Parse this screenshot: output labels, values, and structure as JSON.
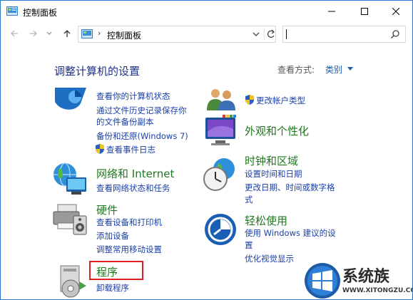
{
  "window": {
    "title": "控制面板",
    "accent": "#2b78d0"
  },
  "address_bar": {
    "separator": "›",
    "path": "控制面板"
  },
  "search": {
    "placeholder": ""
  },
  "header": {
    "heading": "调整计算机的设置",
    "view_by_label": "查看方式:",
    "view_by_value": "类别"
  },
  "categories": {
    "system": {
      "links": [
        "查看你的计算机状态",
        "通过文件历史记录保存你",
        "的文件备份副本",
        "备份和还原(Windows 7)",
        "查看事件日志"
      ]
    },
    "network": {
      "title": "网络和 Internet",
      "links": [
        "查看网络状态和任务"
      ]
    },
    "hardware": {
      "title": "硬件",
      "links": [
        "查看设备和打印机",
        "添加设备",
        "调整常用移动设置"
      ]
    },
    "programs": {
      "title": "程序",
      "links": [
        "卸载程序"
      ]
    },
    "accounts": {
      "links": [
        "更改帐户类型"
      ]
    },
    "appearance": {
      "title": "外观和个性化"
    },
    "clock": {
      "title": "时钟和区域",
      "links": [
        "设置时间和日期",
        "更改日期、时间或数字格",
        "式"
      ]
    },
    "ease": {
      "title": "轻松使用",
      "links": [
        "使用 Windows 建议的设",
        "置",
        "优化视觉显示"
      ]
    }
  },
  "watermark": {
    "title": "系统族",
    "url": "WWW.XITONGZU.COM"
  },
  "colors": {
    "category_title": "#1e7a1e",
    "link": "#1a3fa8",
    "heading": "#1e3287",
    "highlight": "#e02020"
  }
}
